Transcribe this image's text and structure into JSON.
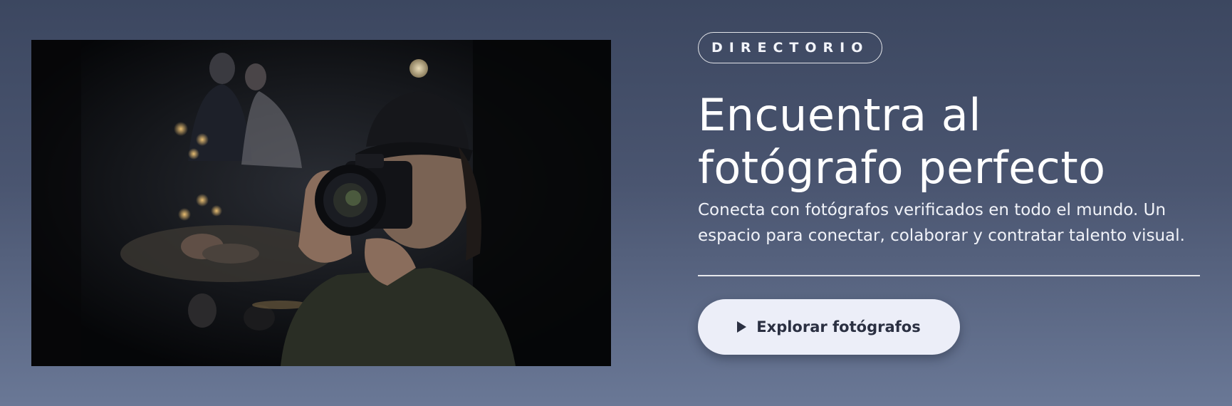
{
  "hero": {
    "image_alt": "Fotógrafa con cámara en un entorno nocturno con escenas de boda y recién nacido"
  },
  "badge": {
    "label": "DIRECTORIO"
  },
  "headline": {
    "line1": "Encuentra al",
    "line2": "fotógrafo perfecto"
  },
  "description": "Conecta con fotógrafos verificados en todo el mundo.  Un espacio para conectar, colaborar y contratar talento visual.",
  "cta": {
    "label": "Explorar fotógrafos",
    "icon": "play-icon"
  },
  "colors": {
    "button_bg": "#eceef8",
    "button_text": "#2b3042",
    "background_top": "#3c4760",
    "background_bottom": "#6a7896"
  }
}
